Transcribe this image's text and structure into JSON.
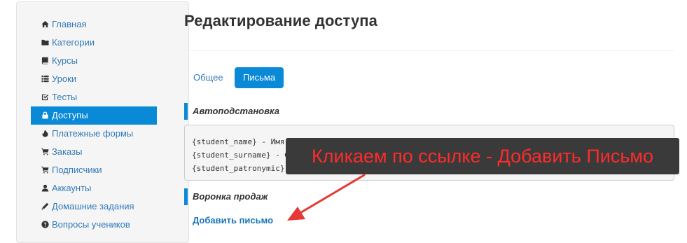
{
  "sidebar": {
    "items": [
      {
        "label": "Главная",
        "icon": "home-icon"
      },
      {
        "label": "Категории",
        "icon": "folder-icon"
      },
      {
        "label": "Курсы",
        "icon": "book-icon"
      },
      {
        "label": "Уроки",
        "icon": "list-icon"
      },
      {
        "label": "Тесты",
        "icon": "edit-check-icon"
      },
      {
        "label": "Доступы",
        "icon": "lock-icon",
        "active": true
      },
      {
        "label": "Платежные формы",
        "icon": "fire-icon"
      },
      {
        "label": "Заказы",
        "icon": "cart-icon"
      },
      {
        "label": "Подписчики",
        "icon": "cart-icon"
      },
      {
        "label": "Аккаунты",
        "icon": "user-icon"
      },
      {
        "label": "Домашние задания",
        "icon": "pencil-icon"
      },
      {
        "label": "Вопросы учеников",
        "icon": "question-icon"
      }
    ]
  },
  "page": {
    "title": "Редактирование доступа"
  },
  "tabs": {
    "general": "Общее",
    "letters": "Письма"
  },
  "autosubst": {
    "heading": "Автоподстановка",
    "lines": [
      "{student_name} - Имя ученика",
      "{student_surname} - Фамилия ученика",
      "{student_patronymic} - Отчество ученика"
    ]
  },
  "funnel": {
    "heading": "Воронка продаж",
    "add_link": "Добавить письмо"
  },
  "annotation": {
    "text": "Кликаем по ссылке - Добавить Письмо",
    "text_color": "#ff2b2b",
    "box_color": "#3a3a3a",
    "arrow_color": "#e53935"
  },
  "colors": {
    "accent": "#0a8ad6",
    "link": "#337ab7"
  }
}
